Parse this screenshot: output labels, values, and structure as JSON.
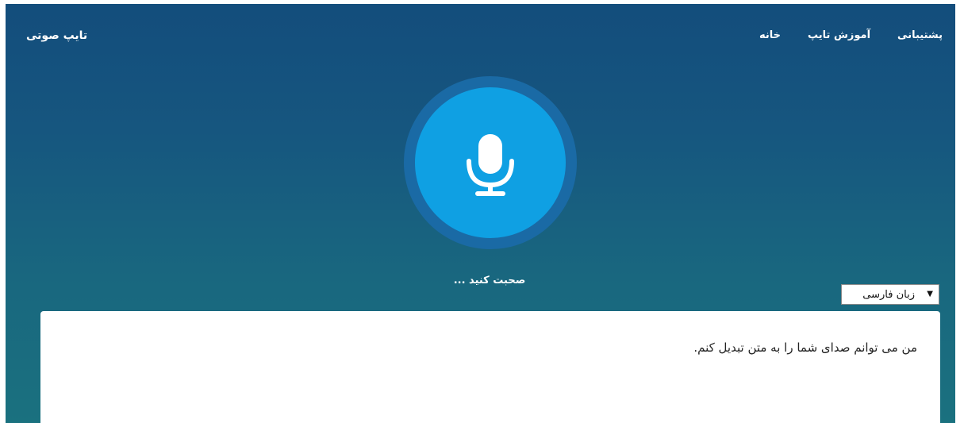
{
  "header": {
    "brand": "تایپ صوتی",
    "nav": [
      {
        "label": "پشتیبانی"
      },
      {
        "label": "آموزش تایپ"
      },
      {
        "label": "خانه"
      }
    ]
  },
  "mic": {
    "icon": "microphone-icon",
    "prompt": "صحبت کنید ..."
  },
  "language": {
    "selected": "زبان فارسی"
  },
  "editor": {
    "text": "من می توانم صدای شما را به متن تبدیل کنم."
  },
  "colors": {
    "header_gradient_top": "#134d7c",
    "header_gradient_bottom": "#1a717f",
    "mic_button": "#0fa0e3",
    "mic_ring": "#1a6aa5"
  }
}
